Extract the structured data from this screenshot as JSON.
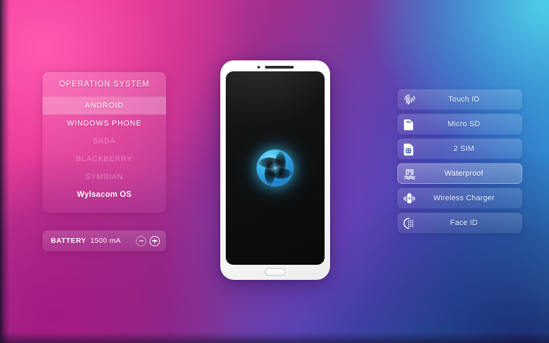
{
  "background": {
    "colors": {
      "top_left": "#f0429c",
      "top_right": "#3bb8e0",
      "bottom_left": "#9c1a82",
      "bottom_right": "#1e2a70",
      "center_violet": "#7b3a9e"
    }
  },
  "os_panel": {
    "header": "OPERATION SYSTEM",
    "items": [
      {
        "label": "ANDROID",
        "state": "selected"
      },
      {
        "label": "WINDOWS PHONE",
        "state": "normal"
      },
      {
        "label": "BADA",
        "state": "disabled"
      },
      {
        "label": "BLACKBERRY",
        "state": "disabled"
      },
      {
        "label": "SYMBIAN",
        "state": "disabled"
      },
      {
        "label": "Wylsacom OS",
        "state": "custom"
      }
    ]
  },
  "battery": {
    "label": "BATTERY",
    "value": "1500 mA",
    "decrease_icon": "minus-circle-icon",
    "increase_icon": "plus-circle-icon"
  },
  "phone": {
    "camera_icon": "front-camera-dot-icon",
    "speaker_icon": "earpiece-speaker-icon",
    "logo_icon": "wylsacom-logo-icon",
    "home_button_icon": "home-button-icon",
    "screen_color": "#0d0d0d",
    "body_color": "#ffffff",
    "logo_color": "#43c6f0"
  },
  "features": [
    {
      "label": "Touch ID",
      "icon": "fingerprint-icon",
      "state": "normal"
    },
    {
      "label": "Micro SD",
      "icon": "sd-card-icon",
      "state": "normal"
    },
    {
      "label": "2 SIM",
      "icon": "sim-card-icon",
      "state": "normal"
    },
    {
      "label": "Waterproof",
      "icon": "waterproof-icon",
      "state": "highlight"
    },
    {
      "label": "Wireless Charger",
      "icon": "wireless-charging-icon",
      "state": "normal"
    },
    {
      "label": "Face ID",
      "icon": "face-id-icon",
      "state": "normal"
    }
  ]
}
